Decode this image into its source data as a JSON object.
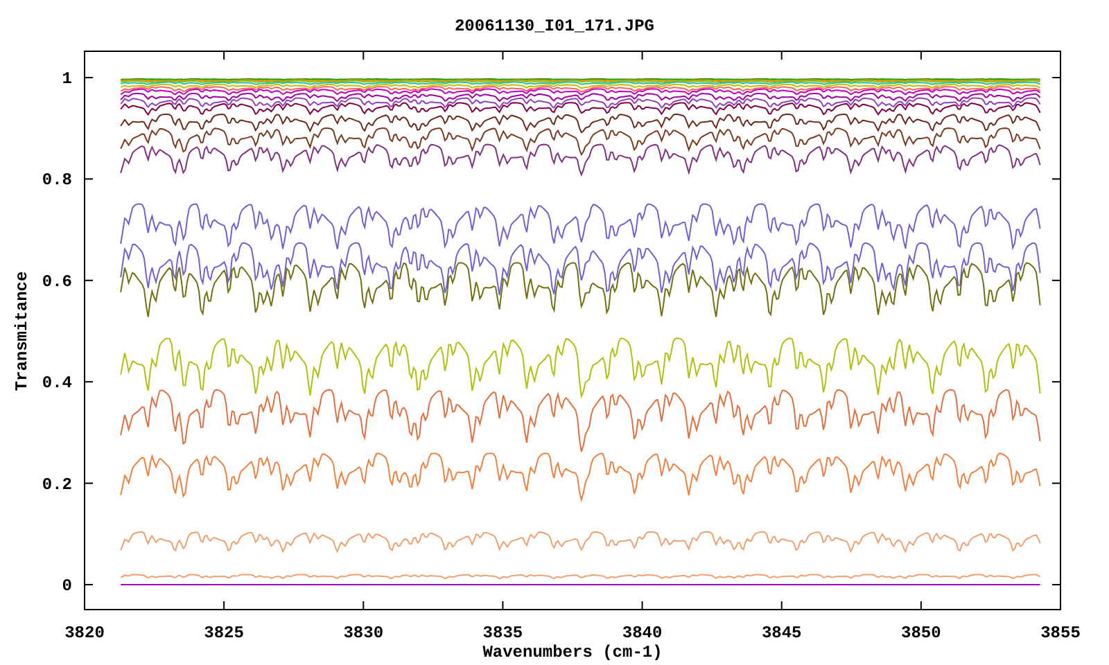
{
  "title": "20061130_I01_171.JPG",
  "x_axis": {
    "label": "Wavenumbers (cm-1)",
    "ticks": [
      "3820",
      "3825",
      "3830",
      "3835",
      "3840",
      "3845",
      "3850",
      "3855"
    ]
  },
  "y_axis": {
    "label": "Transmitance",
    "ticks": [
      "1",
      "0.8",
      "0.6",
      "0.4",
      "0.2",
      "0"
    ]
  }
}
